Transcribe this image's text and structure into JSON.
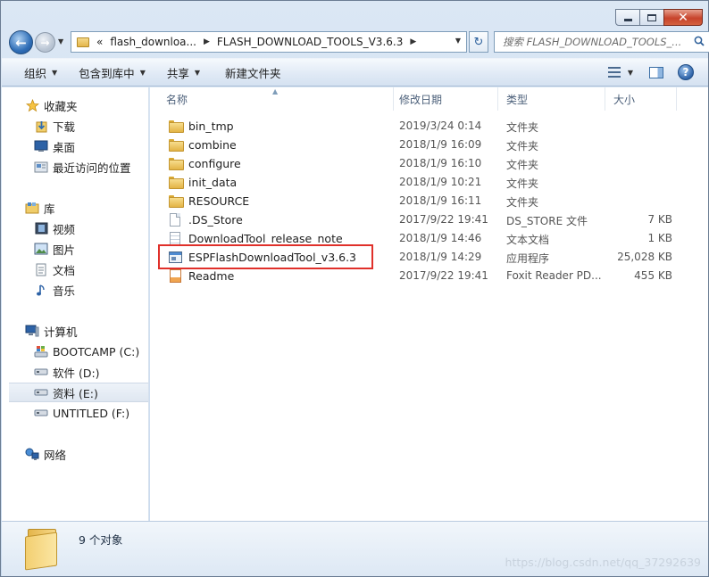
{
  "window": {
    "close_glyph": "✕"
  },
  "address": {
    "prefix": "«",
    "crumbs": [
      "flash_downloa...",
      "FLASH_DOWNLOAD_TOOLS_V3.6.3"
    ]
  },
  "search": {
    "placeholder": "搜索 FLASH_DOWNLOAD_TOOLS_..."
  },
  "toolbar": {
    "organize": "组织",
    "include_in_library": "包含到库中",
    "share": "共享",
    "new_folder": "新建文件夹",
    "help": "?"
  },
  "nav_pane": {
    "favorites": {
      "label": "收藏夹",
      "items": [
        "下载",
        "桌面",
        "最近访问的位置"
      ]
    },
    "libraries": {
      "label": "库",
      "items": [
        "视频",
        "图片",
        "文档",
        "音乐"
      ]
    },
    "computer": {
      "label": "计算机",
      "items": [
        "BOOTCAMP (C:)",
        "软件 (D:)",
        "资料 (E:)",
        "UNTITLED (F:)"
      ]
    },
    "network": {
      "label": "网络"
    }
  },
  "columns": {
    "name": "名称",
    "date": "修改日期",
    "type": "类型",
    "size": "大小"
  },
  "files": [
    {
      "name": "bin_tmp",
      "date": "2019/3/24 0:14",
      "type": "文件夹",
      "size": "",
      "icon": "folder-icon"
    },
    {
      "name": "combine",
      "date": "2018/1/9 16:09",
      "type": "文件夹",
      "size": "",
      "icon": "folder-icon"
    },
    {
      "name": "configure",
      "date": "2018/1/9 16:10",
      "type": "文件夹",
      "size": "",
      "icon": "folder-icon"
    },
    {
      "name": "init_data",
      "date": "2018/1/9 10:21",
      "type": "文件夹",
      "size": "",
      "icon": "folder-icon"
    },
    {
      "name": "RESOURCE",
      "date": "2018/1/9 16:11",
      "type": "文件夹",
      "size": "",
      "icon": "folder-icon"
    },
    {
      "name": ".DS_Store",
      "date": "2017/9/22 19:41",
      "type": "DS_STORE 文件",
      "size": "7 KB",
      "icon": "file-icon"
    },
    {
      "name": "DownloadTool_release_note",
      "date": "2018/1/9 14:46",
      "type": "文本文档",
      "size": "1 KB",
      "icon": "text-file-icon"
    },
    {
      "name": "ESPFlashDownloadTool_v3.6.3",
      "date": "2018/1/9 14:29",
      "type": "应用程序",
      "size": "25,028 KB",
      "icon": "application-icon"
    },
    {
      "name": "Readme",
      "date": "2017/9/22 19:41",
      "type": "Foxit Reader PD...",
      "size": "455 KB",
      "icon": "pdf-icon"
    }
  ],
  "status": {
    "count": "9 个对象"
  },
  "watermark": "https://blog.csdn.net/qq_37292639",
  "colors": {
    "highlight_box": "#e0302a",
    "selected_drive_bg": "#e4ebf4"
  }
}
